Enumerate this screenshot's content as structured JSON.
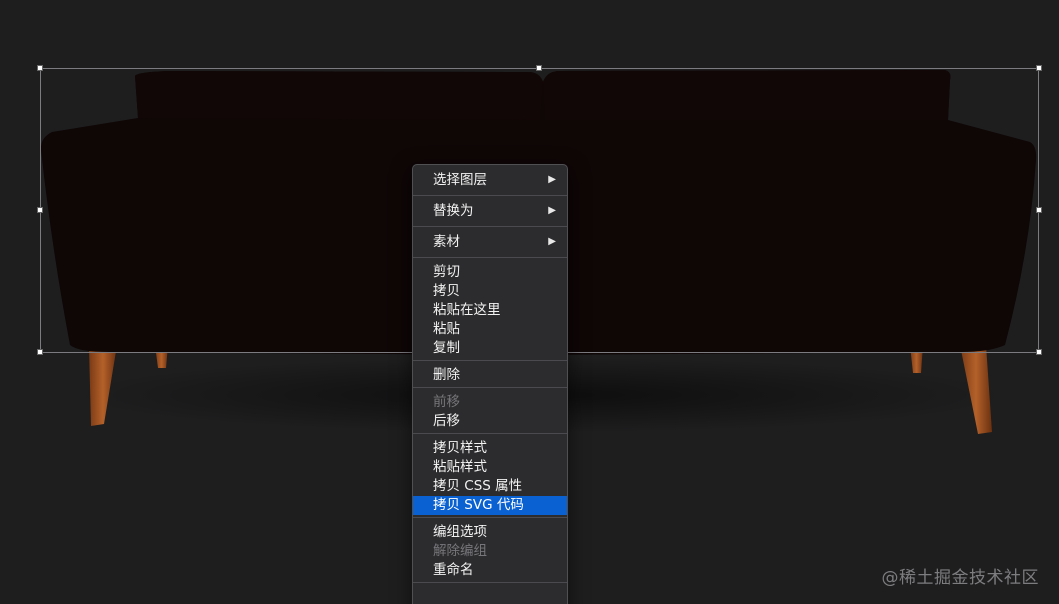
{
  "canvas": {
    "image_subject": "sofa-image",
    "background_color": "#1e1e1f"
  },
  "context_menu": {
    "highlight_color": "#0a61d1",
    "groups": [
      [
        {
          "label": "选择图层",
          "submenu": true
        }
      ],
      [
        {
          "label": "替换为",
          "submenu": true
        }
      ],
      [
        {
          "label": "素材",
          "submenu": true
        }
      ],
      [
        {
          "label": "剪切"
        },
        {
          "label": "拷贝"
        },
        {
          "label": "粘贴在这里"
        },
        {
          "label": "粘贴"
        },
        {
          "label": "复制"
        }
      ],
      [
        {
          "label": "删除"
        }
      ],
      [
        {
          "label": "前移",
          "disabled": true
        },
        {
          "label": "后移"
        }
      ],
      [
        {
          "label": "拷贝样式"
        },
        {
          "label": "粘贴样式"
        },
        {
          "label": "拷贝 CSS 属性"
        },
        {
          "label": "拷贝 SVG 代码",
          "highlighted": true
        }
      ],
      [
        {
          "label": "编组选项"
        },
        {
          "label": "解除编组",
          "disabled": true
        },
        {
          "label": "重命名"
        }
      ]
    ],
    "submenu_arrow_glyph": "▶"
  },
  "watermark": {
    "text": "@稀土掘金技术社区"
  }
}
